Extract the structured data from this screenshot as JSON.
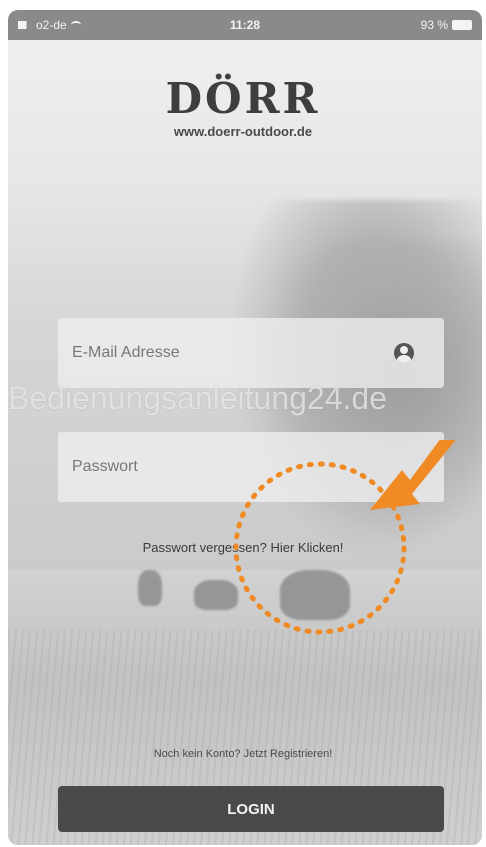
{
  "status_bar": {
    "carrier": "o2-de",
    "time": "11:28",
    "battery": "93 %",
    "icons": [
      "signal-icon",
      "wifi-icon",
      "battery-icon"
    ]
  },
  "brand": {
    "logo_text": "DÖRR",
    "url": "www.doerr-outdoor.de"
  },
  "form": {
    "email_placeholder": "E-Mail Adresse",
    "email_icon": "person-icon",
    "password_placeholder": "Passwort",
    "forgot_link": "Passwort vergessen? Hier Klicken!",
    "register_link": "Noch kein Konto? Jetzt Registrieren!",
    "login_button": "LOGIN"
  },
  "watermark": "Bedienungsanleitung24.de",
  "annotation": {
    "color": "#f08a24",
    "shapes": [
      "dotted-circle",
      "arrow"
    ]
  }
}
